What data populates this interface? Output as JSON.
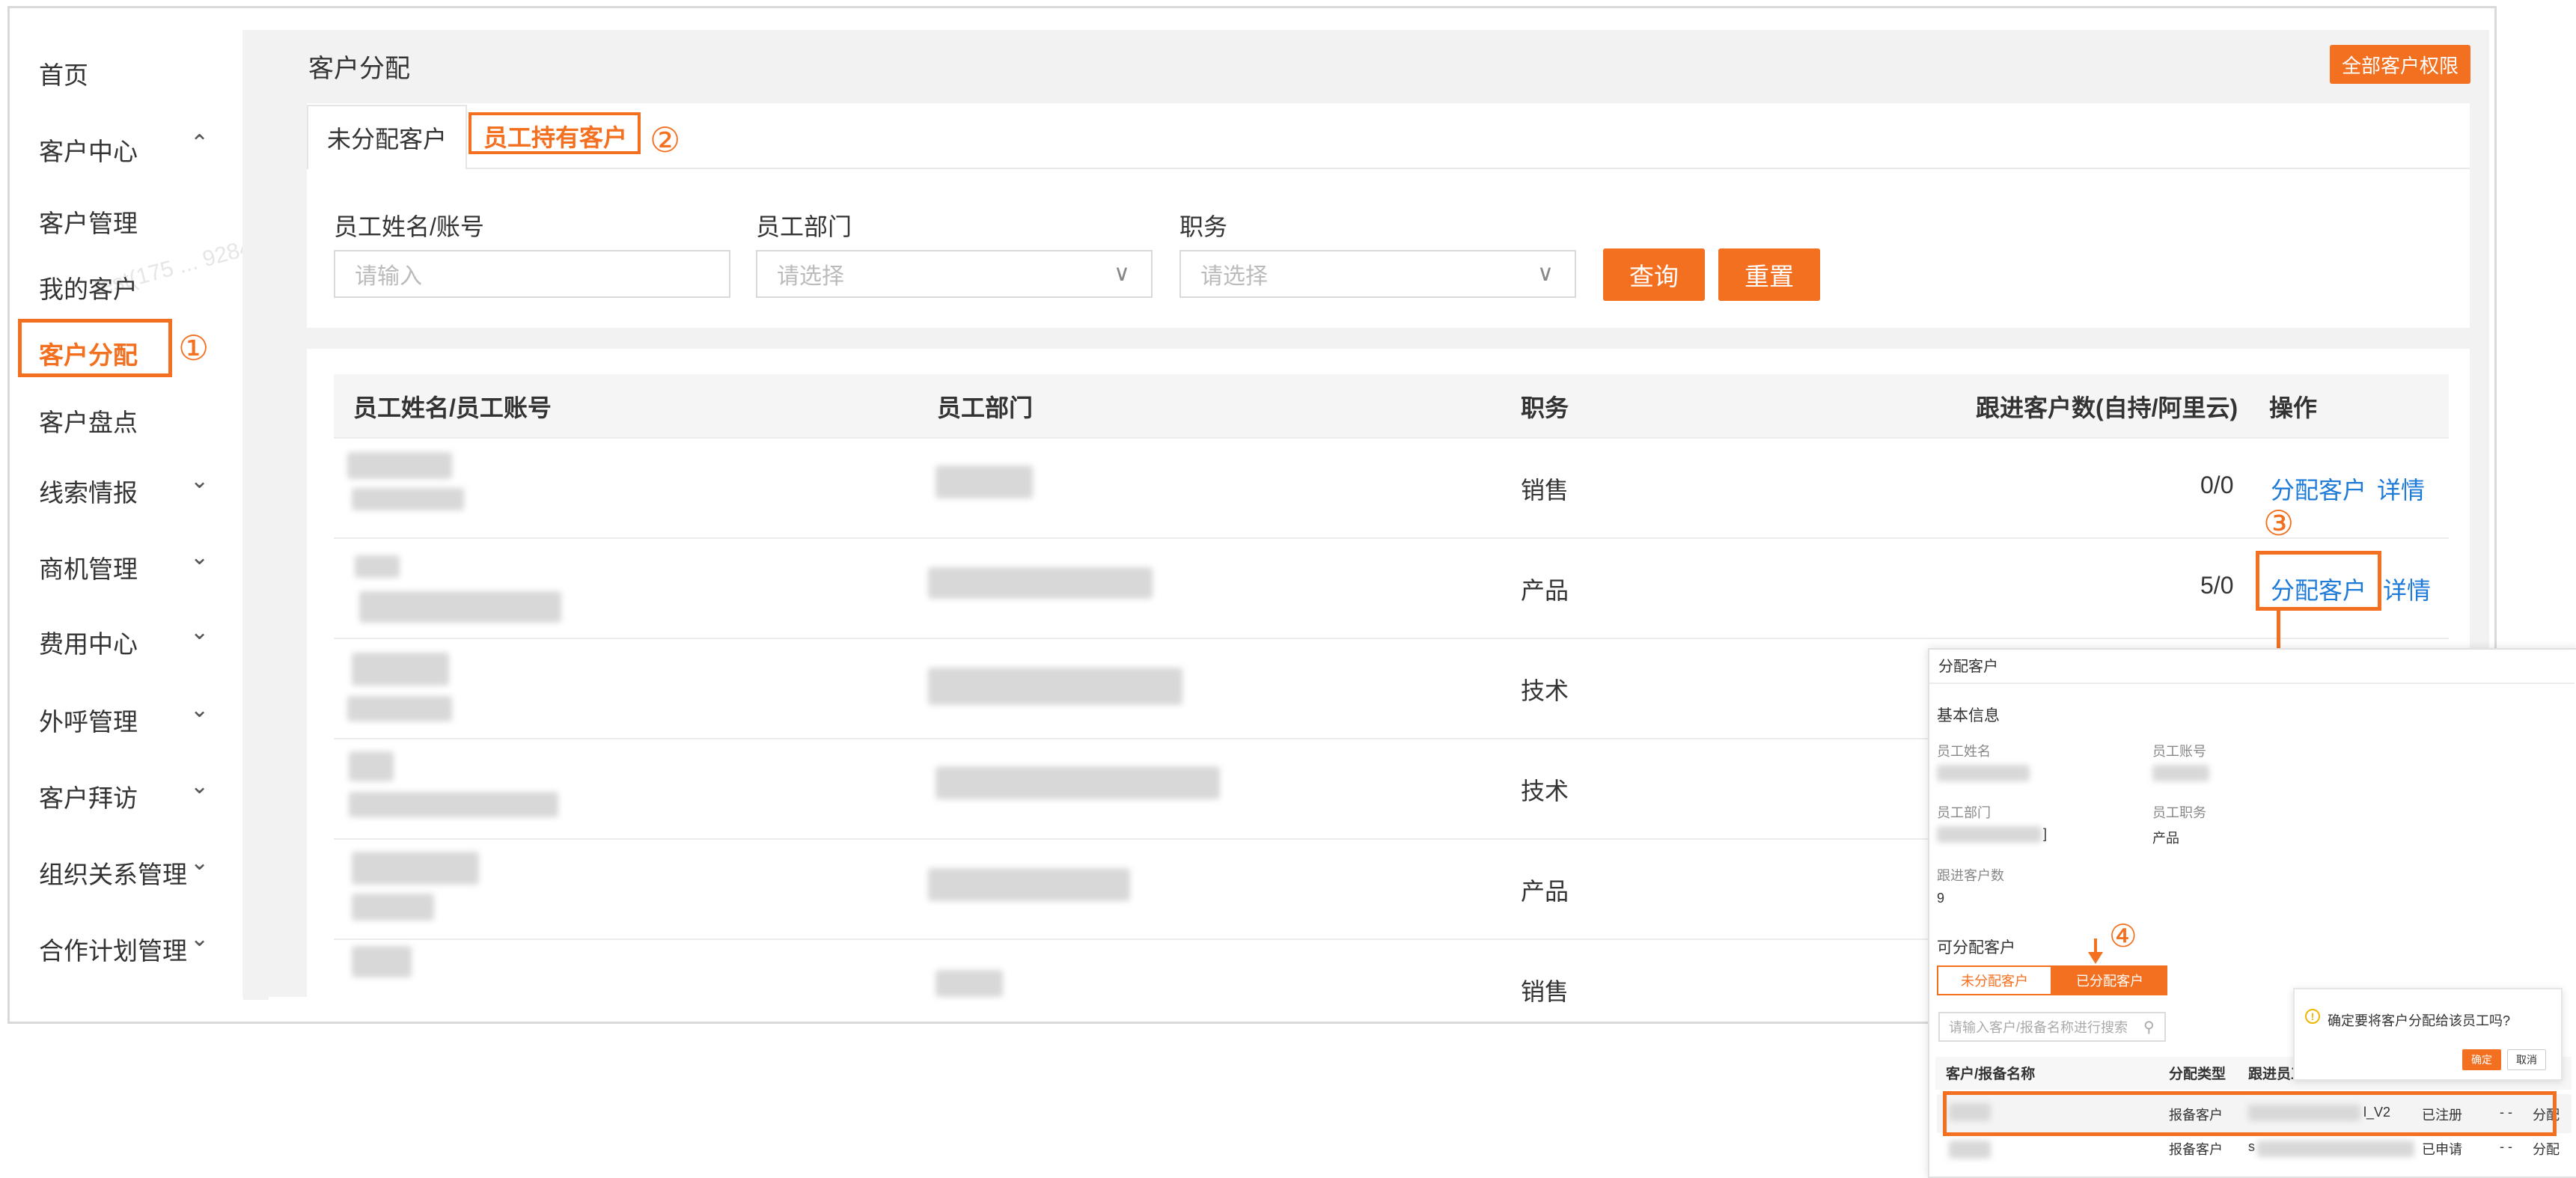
{
  "sidebar": {
    "items": [
      {
        "label": "首页"
      },
      {
        "label": "客户中心"
      },
      {
        "label": "客户管理"
      },
      {
        "label": "我的客户"
      },
      {
        "label": "客户分配"
      },
      {
        "label": "客户盘点"
      },
      {
        "label": "线索情报"
      },
      {
        "label": "商机管理"
      },
      {
        "label": "费用中心"
      },
      {
        "label": "外呼管理"
      },
      {
        "label": "客户拜访"
      },
      {
        "label": "组织关系管理"
      },
      {
        "label": "合作计划管理"
      }
    ]
  },
  "page": {
    "title": "客户分配",
    "all_permission_button": "全部客户权限",
    "tabs": [
      {
        "label": "未分配客户"
      },
      {
        "label": "员工持有客户"
      }
    ]
  },
  "filters": {
    "name_label": "员工姓名/账号",
    "name_placeholder": "请输入",
    "dept_label": "员工部门",
    "dept_placeholder": "请选择",
    "role_label": "职务",
    "role_placeholder": "请选择",
    "query_button": "查询",
    "reset_button": "重置"
  },
  "table": {
    "headers": [
      "员工姓名/员工账号",
      "员工部门",
      "职务",
      "跟进客户数(自持/阿里云)",
      "操作"
    ],
    "rows": [
      {
        "role": "销售",
        "count": "0/0",
        "assign": "分配客户",
        "detail": "详情"
      },
      {
        "role": "产品",
        "count": "5/0",
        "assign": "分配客户",
        "detail": "详情"
      },
      {
        "role": "技术"
      },
      {
        "role": "技术"
      },
      {
        "role": "产品"
      },
      {
        "role": "销售"
      }
    ]
  },
  "annotations": [
    "①",
    "②",
    "③",
    "④"
  ],
  "dialog": {
    "title": "分配客户",
    "basic_info": "基本信息",
    "name_label": "员工姓名",
    "account_label": "员工账号",
    "dept_label": "员工部门",
    "dept_value_tail": "]",
    "role_label": "员工职务",
    "role_value": "产品",
    "follow_label": "跟进客户数",
    "follow_value": "9",
    "assignable": "可分配客户",
    "tab_unassigned": "未分配客户",
    "tab_assigned": "已分配客户",
    "search_placeholder": "请输入客户/报备名称进行搜索",
    "headers": [
      "客户/报备名称",
      "分配类型",
      "跟进员工"
    ],
    "rows": [
      {
        "type": "报备客户",
        "emp_tail": "l_V2",
        "status": "已注册",
        "dash": "- -",
        "action": "分配"
      },
      {
        "type": "报备客户",
        "emp_tail": "s",
        "status": "已申请",
        "dash": "- -",
        "action": "分配"
      }
    ]
  },
  "confirm": {
    "message": "确定要将客户分配给该员工吗?",
    "ok": "确定",
    "cancel": "取消"
  }
}
